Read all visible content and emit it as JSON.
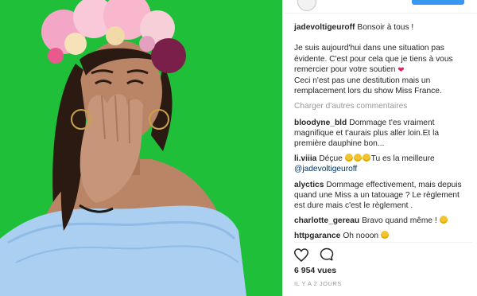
{
  "post": {
    "caption_user": "jadevoltigeuroff",
    "caption_text": "Bonsoir à tous !\n\nJe suis aujourd'hui dans une situation pas évidente. C'est pour cela que je tiens à vous remercier pour votre soutien",
    "caption_text_2": "Ceci n'est pas une destitution mais un remplacement lors du show Miss France.",
    "load_more_label": "Charger d'autres commentaires",
    "comments": [
      {
        "user": "bloodyne_bld",
        "text": "Dommage t'es vraiment magnifique et t'aurais plus aller loin.Et la première dauphine bon..."
      },
      {
        "user": "li.viiia",
        "text": "Déçue",
        "text_2": "Tu es la meilleure",
        "mention": "@jadevoltigeuroff"
      },
      {
        "user": "alyctics",
        "text": "Dommage effectivement, mais depuis quand une Miss a un tatouage ? Le règlement est dure mais c'est le règlement ."
      },
      {
        "user": "charlotte_gereau",
        "text": "Bravo quand même !"
      },
      {
        "user": "httpgarance",
        "text": "Oh nooon"
      }
    ],
    "views": "6 954 vues",
    "timestamp": "IL Y A 2 JOURS"
  },
  "icons": {
    "like": "heart-outline-icon",
    "comment": "comment-bubble-icon"
  },
  "colors": {
    "background_green": "#1fbf3a",
    "link": "#003569",
    "muted": "#999999"
  }
}
